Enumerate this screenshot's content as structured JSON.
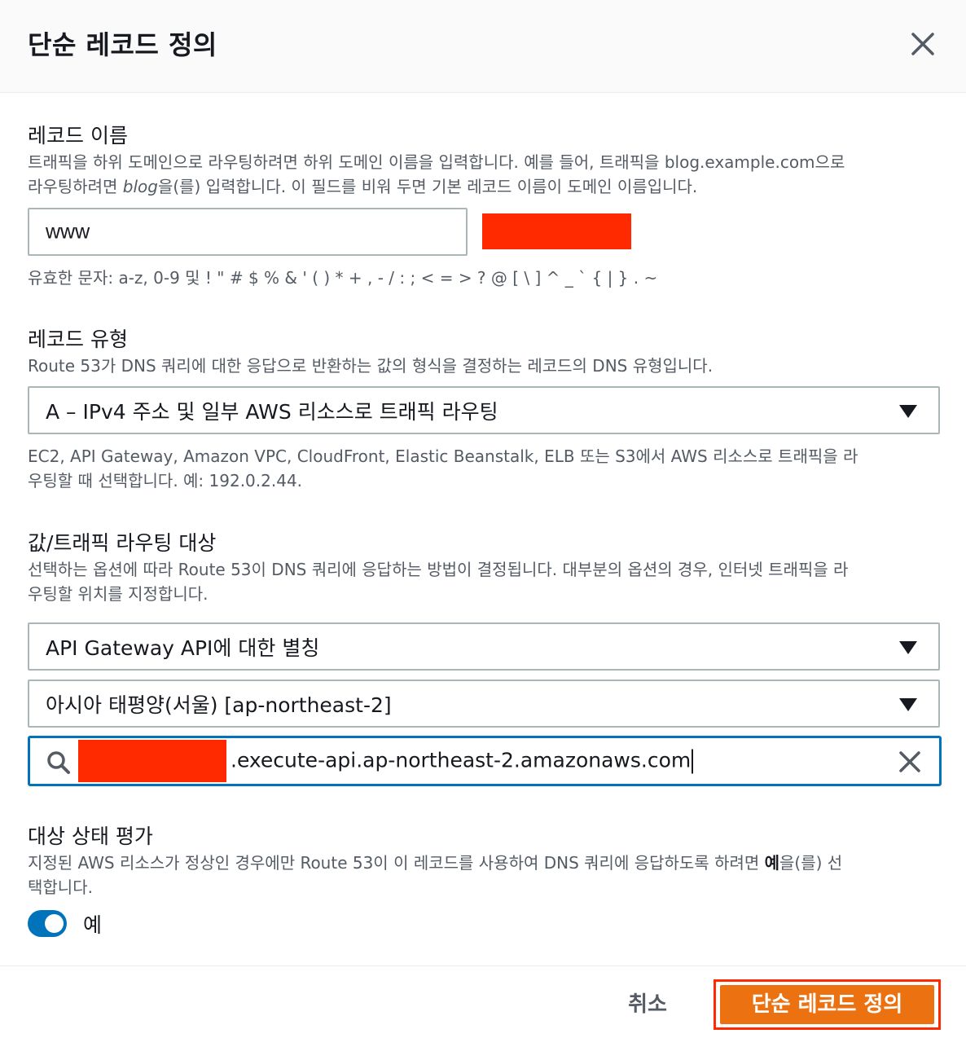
{
  "dialog": {
    "title": "단순 레코드 정의"
  },
  "record_name": {
    "label": "레코드 이름",
    "desc_line1": "트래픽을 하위 도메인으로 라우팅하려면 하위 도메인 이름을 입력합니다. 예를 들어, 트래픽을 blog.example.com으로",
    "desc_line2_prefix": "라우팅하려면 ",
    "desc_line2_em": "blog",
    "desc_line2_suffix": "을(를) 입력합니다. 이 필드를 비워 두면 기본 레코드 이름이 도메인 이름입니다.",
    "value": "www",
    "allowed_chars": "유효한 문자: a-z, 0-9 및 ! \" # $ % & ' ( ) * + , - / : ; < = > ? @ [ \\ ] ^ _ ` { | } . ~"
  },
  "record_type": {
    "label": "레코드 유형",
    "desc": "Route 53가 DNS 쿼리에 대한 응답으로 반환하는 값의 형식을 결정하는 레코드의 DNS 유형입니다.",
    "selected": "A – IPv4 주소 및 일부 AWS 리소스로 트래픽 라우팅",
    "hint_line1": "EC2, API Gateway, Amazon VPC, CloudFront, Elastic Beanstalk, ELB 또는 S3에서 AWS 리소스로 트래픽을 라",
    "hint_line2": "우팅할 때 선택합니다. 예: 192.0.2.44."
  },
  "route_target": {
    "label": "값/트래픽 라우팅 대상",
    "desc_line1": "선택하는 옵션에 따라 Route 53이 DNS 쿼리에 응답하는 방법이 결정됩니다. 대부분의 옵션의 경우, 인터넷 트래픽을 라",
    "desc_line2": "우팅할 위치를 지정합니다.",
    "endpoint_type": "API Gateway API에 대한 별칭",
    "region": "아시아 태평양(서울) [ap-northeast-2]",
    "search_value": ".execute-api.ap-northeast-2.amazonaws.com"
  },
  "health": {
    "label": "대상 상태 평가",
    "desc_line1_prefix": "지정된 AWS 리소스가 정상인 경우에만 Route 53이 이 레코드를 사용하여 DNS 쿼리에 응답하도록 하려면 ",
    "desc_line1_bold": "예",
    "desc_line1_suffix": "을(를) 선",
    "desc_line2": "택합니다.",
    "toggle_label": "예",
    "toggle_on": true
  },
  "footer": {
    "cancel_label": "취소",
    "submit_label": "단순 레코드 정의"
  },
  "colors": {
    "primary_button": "#ec7211",
    "focus_border": "#0073bb",
    "redaction": "#ff2a00"
  }
}
